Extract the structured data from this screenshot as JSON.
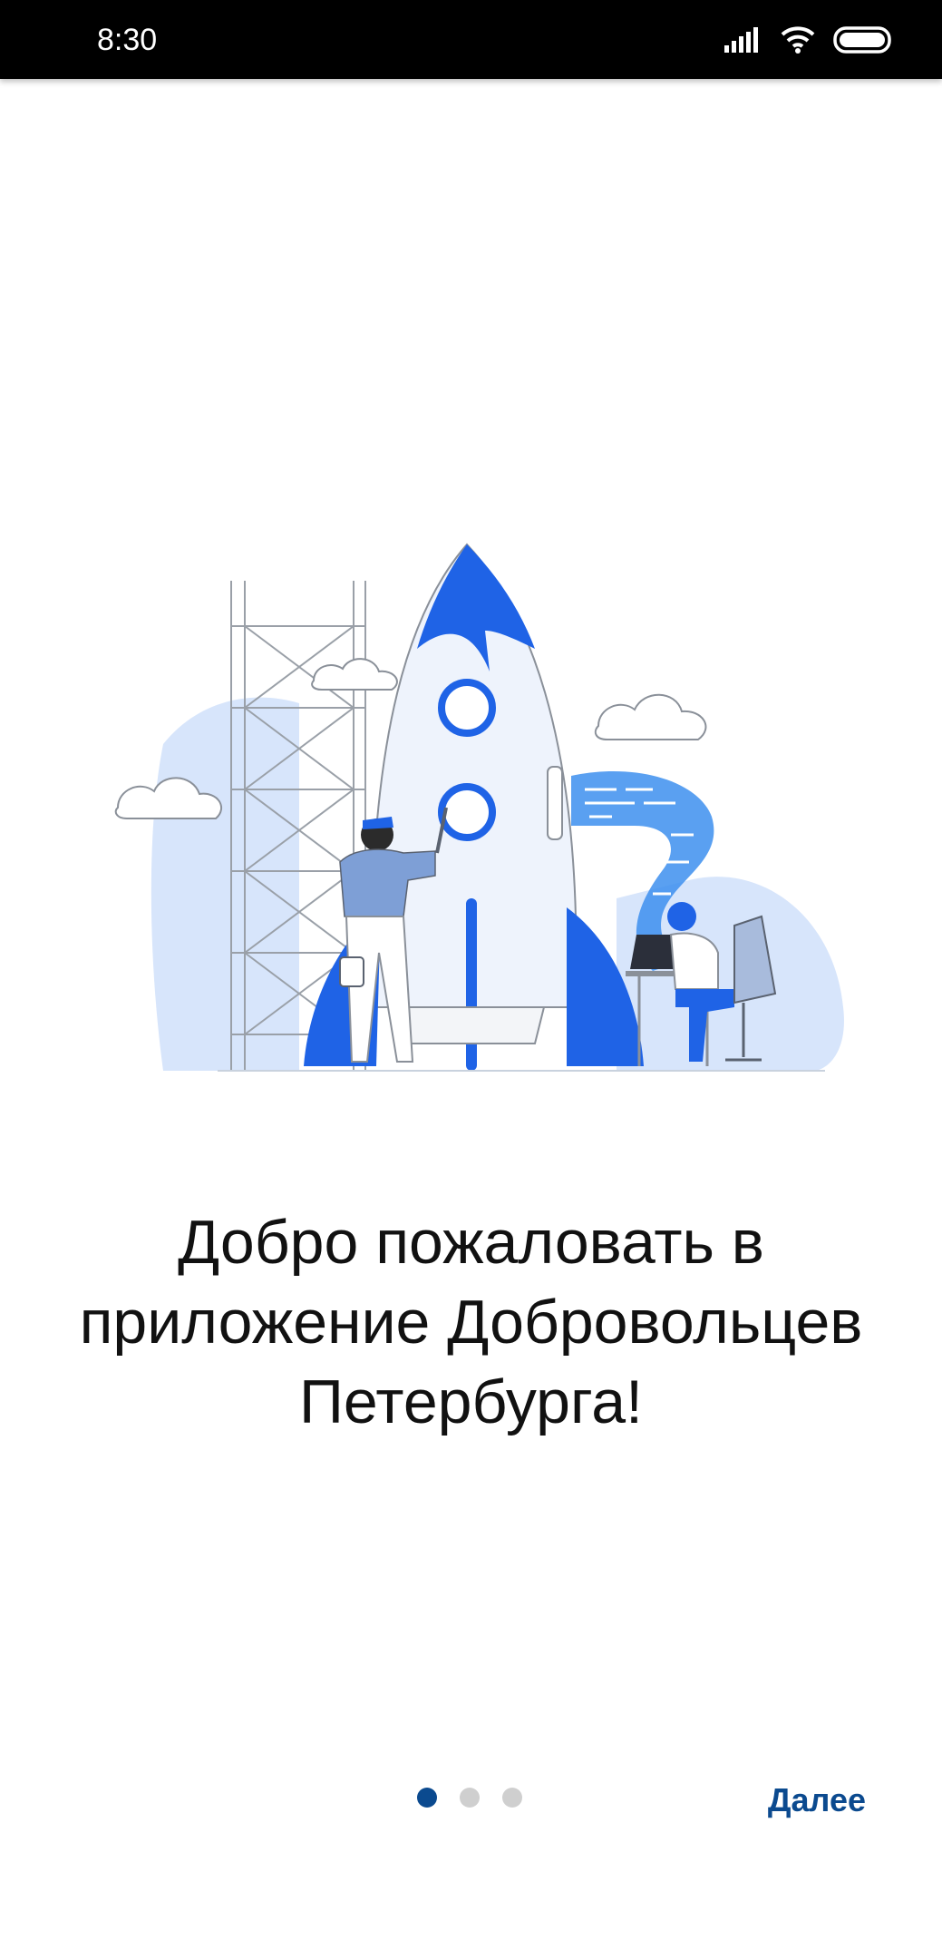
{
  "status_bar": {
    "time": "8:30",
    "icons": [
      "signal-icon",
      "wifi-icon",
      "battery-icon"
    ]
  },
  "onboarding": {
    "title_lines": [
      "Добро пожаловать в",
      "приложение Добровольцев",
      "Петербурга!"
    ],
    "illustration": "rocket-illustration",
    "pages": 3,
    "current_page": 1,
    "next_label": "Далее"
  },
  "colors": {
    "primary": "#0b4a8f",
    "illustration_blue": "#1f63e6",
    "illustration_light": "#d7e5fb",
    "dot_inactive": "#cfcfcf"
  }
}
